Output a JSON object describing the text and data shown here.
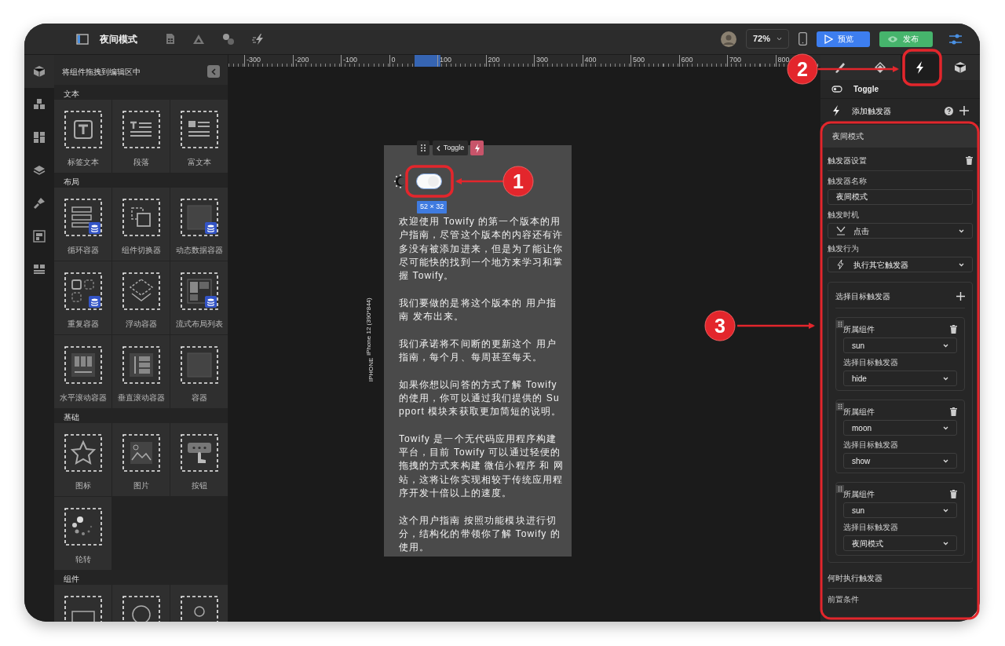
{
  "topbar": {
    "title": "夜间模式",
    "zoom": "72%",
    "buttons": [
      {
        "label": "预览",
        "kind": "preview"
      },
      {
        "label": "发布",
        "kind": "publish"
      }
    ]
  },
  "left_rail": {
    "items": [
      {
        "kind": "cube",
        "selected": true
      },
      {
        "kind": "cubes",
        "selected": false
      },
      {
        "kind": "blocks",
        "selected": false
      },
      {
        "kind": "layers",
        "selected": false
      },
      {
        "kind": "brush",
        "selected": false
      },
      {
        "kind": "pages",
        "selected": false
      },
      {
        "kind": "rows",
        "selected": false
      }
    ]
  },
  "widget_panel": {
    "header": "将组件拖拽到编辑区中",
    "sections": [
      {
        "title": "文本",
        "widgets": [
          {
            "kind": "text",
            "label": "标签文本",
            "database": false
          },
          {
            "kind": "paragraph",
            "label": "段落",
            "database": false
          },
          {
            "kind": "richtext",
            "label": "富文本",
            "database": false
          }
        ]
      },
      {
        "title": "布局",
        "widgets": [
          {
            "kind": "loop",
            "label": "循环容器",
            "database": true
          },
          {
            "kind": "switcher",
            "label": "组件切换器",
            "database": false
          },
          {
            "kind": "square",
            "label": "动态数据容器",
            "database": true
          },
          {
            "kind": "repeat",
            "label": "重复容器",
            "database": true
          },
          {
            "kind": "float",
            "label": "浮动容器",
            "database": false
          },
          {
            "kind": "flow",
            "label": "流式布局列表",
            "database": true
          },
          {
            "kind": "hscroll",
            "label": "水平滚动容器",
            "database": false
          },
          {
            "kind": "vscroll",
            "label": "垂直滚动容器",
            "database": false
          },
          {
            "kind": "square",
            "label": "容器",
            "database": false
          }
        ]
      },
      {
        "title": "基础",
        "widgets": [
          {
            "kind": "star",
            "label": "图标",
            "database": false
          },
          {
            "kind": "image",
            "label": "图片",
            "database": false
          },
          {
            "kind": "button",
            "label": "按钮",
            "database": false
          },
          {
            "kind": "carousel",
            "label": "轮转",
            "database": false
          }
        ]
      },
      {
        "title": "组件",
        "widgets": [
          {
            "kind": "panel",
            "database": false
          },
          {
            "kind": "timer",
            "database": false
          },
          {
            "kind": "pin",
            "database": false
          }
        ]
      }
    ]
  },
  "ruler": {
    "labels": [
      "-300",
      "-200",
      "-100",
      "0",
      "100",
      "200",
      "300",
      "400",
      "500",
      "600",
      "700",
      "800"
    ]
  },
  "canvas": {
    "device_label": "IPHONE",
    "device_model": "iPhone 12 (390*844)",
    "toolbar_label": "Toggle",
    "toggle": {
      "on": true
    },
    "size_badge": "52 × 32",
    "paragraphs": [
      "欢迎使用 Towify 的第一个版本的用户指南，尽管这个版本的内容还有许多没有被添加进来，但是为了能让你尽可能快的找到一个地方来学习和掌握 Towify。",
      "我们要做的是将这个版本的 用户指南 发布出来。",
      "我们承诺将不间断的更新这个 用户指南，每个月、每周甚至每天。",
      "如果你想以问答的方式了解 Towify 的使用，你可以通过我们提供的 Support 模块来获取更加简短的说明。",
      "Towify 是一个无代码应用程序构建平台，目前 Towify 可以通过轻便的拖拽的方式来构建 微信小程序 和 网站，这将让你实现相较于传统应用程序开发十倍以上的速度。",
      "这个用户指南 按照功能模块进行切分，结构化的带领你了解 Towify 的使用。"
    ]
  },
  "right_panel": {
    "tabs": [
      {
        "kind": "brush",
        "selected": false
      },
      {
        "kind": "diamond",
        "selected": false
      },
      {
        "kind": "bolt",
        "selected": true
      },
      {
        "kind": "box",
        "selected": false
      }
    ],
    "component": "Toggle",
    "add_trigger": "添加触发器",
    "trigger": {
      "title": "夜间模式",
      "settings_title": "触发器设置",
      "fields": [
        {
          "kind": "input",
          "label": "触发器名称",
          "value": "夜间模式"
        },
        {
          "kind": "select",
          "label": "触发时机",
          "value": "点击"
        },
        {
          "kind": "select",
          "label": "触发行为",
          "value": "执行其它触发器"
        }
      ],
      "targets_title": "选择目标触发器",
      "targets": [
        {
          "component_label": "所属组件",
          "component": "sun",
          "trigger_label": "选择目标触发器",
          "trigger": "hide"
        },
        {
          "component_label": "所属组件",
          "component": "moon",
          "trigger_label": "选择目标触发器",
          "trigger": "show"
        },
        {
          "component_label": "所属组件",
          "component": "sun",
          "trigger_label": "选择目标触发器",
          "trigger": "夜间模式"
        }
      ],
      "when_title": "何时执行触发器",
      "precondition_label": "前置条件"
    }
  },
  "annotations": {
    "markers": [
      {
        "number": "1"
      },
      {
        "number": "2"
      },
      {
        "number": "3"
      }
    ]
  }
}
